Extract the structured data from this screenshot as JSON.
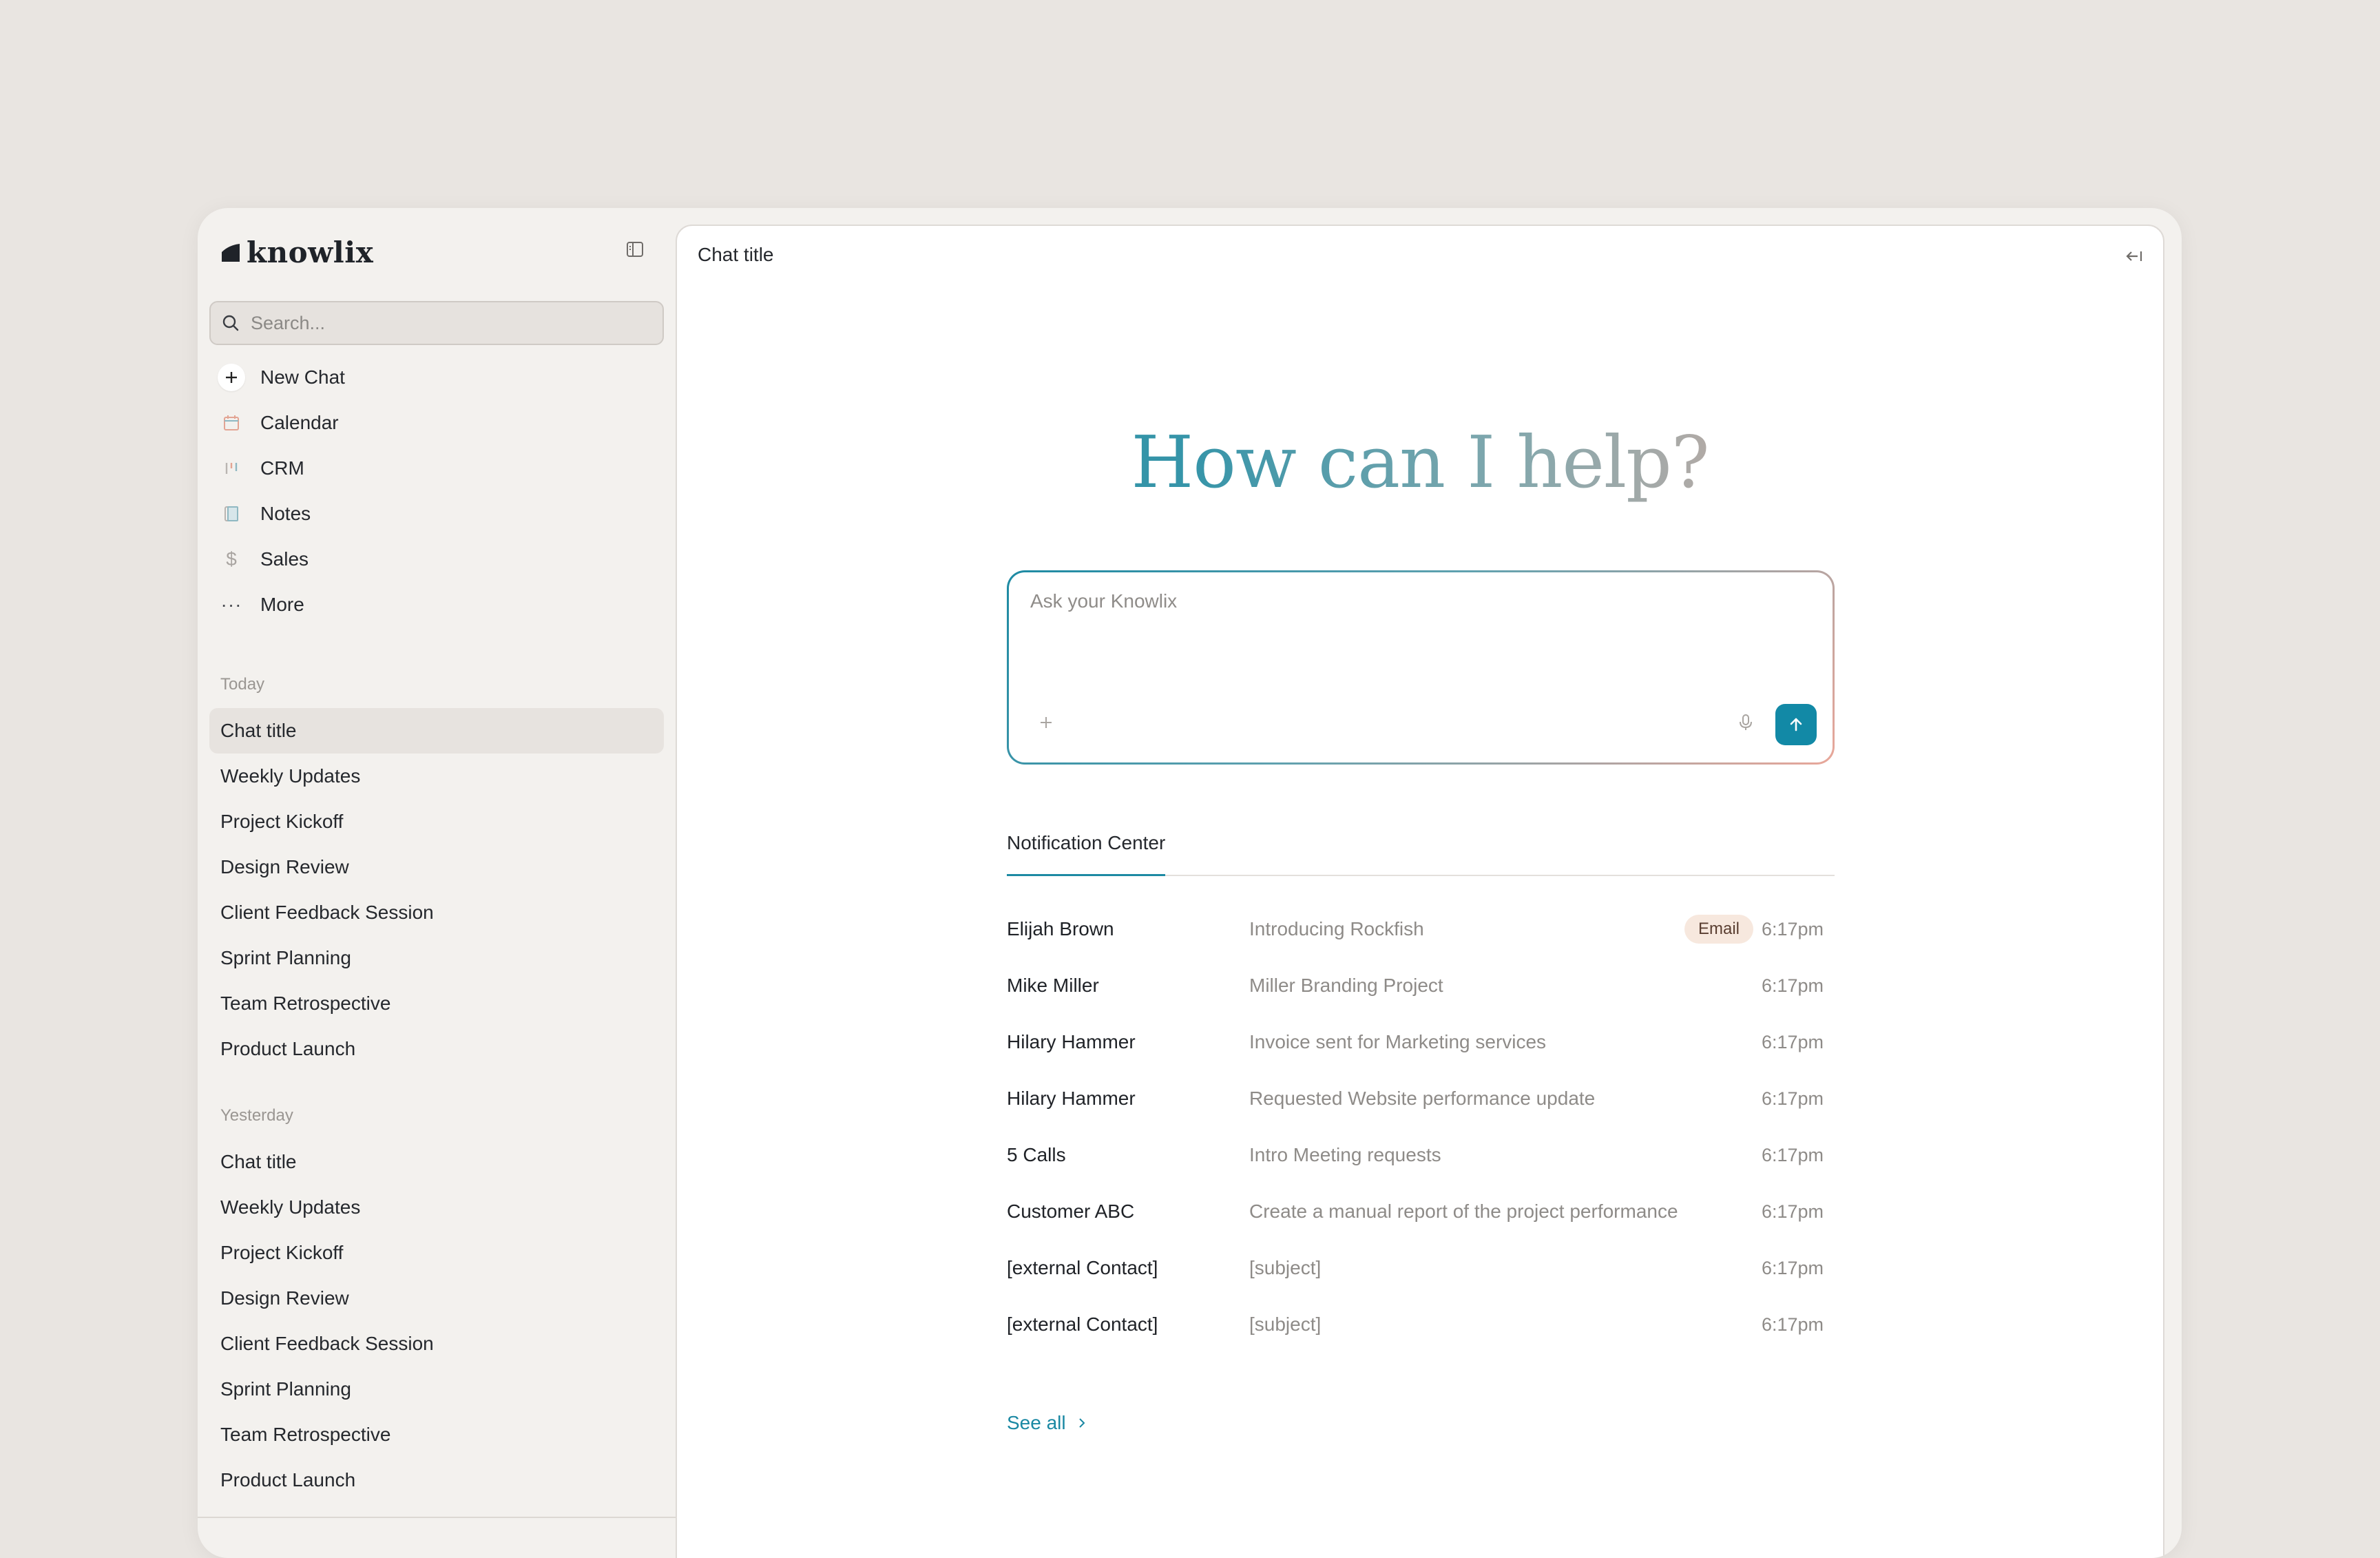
{
  "brand": {
    "name": "knowlix"
  },
  "search": {
    "placeholder": "Search..."
  },
  "nav": [
    {
      "label": "New Chat",
      "icon": "plus-icon"
    },
    {
      "label": "Calendar",
      "icon": "calendar-icon"
    },
    {
      "label": "CRM",
      "icon": "crm-icon"
    },
    {
      "label": "Notes",
      "icon": "notes-icon"
    },
    {
      "label": "Sales",
      "icon": "dollar-icon"
    },
    {
      "label": "More",
      "icon": "ellipsis-icon"
    }
  ],
  "history": {
    "today_label": "Today",
    "today": [
      "Chat title",
      "Weekly Updates",
      "Project Kickoff",
      "Design Review",
      "Client Feedback Session",
      "Sprint Planning",
      "Team Retrospective",
      "Product Launch"
    ],
    "yesterday_label": "Yesterday",
    "yesterday": [
      "Chat title",
      "Weekly Updates",
      "Project Kickoff",
      "Design Review",
      "Client Feedback Session",
      "Sprint Planning",
      "Team Retrospective",
      "Product Launch"
    ]
  },
  "header": {
    "title": "Chat title"
  },
  "hero": {
    "title": "How can I help?"
  },
  "prompt": {
    "placeholder": "Ask your Knowlix"
  },
  "notifications": {
    "tab": "Notification Center",
    "rows": [
      {
        "sender": "Elijah Brown",
        "subject": "Introducing Rockfish",
        "badge": "Email",
        "time": "6:17pm"
      },
      {
        "sender": "Mike Miller",
        "subject": "Miller Branding Project",
        "badge": "",
        "time": "6:17pm"
      },
      {
        "sender": "Hilary Hammer",
        "subject": "Invoice sent for Marketing services",
        "badge": "",
        "time": "6:17pm"
      },
      {
        "sender": "Hilary Hammer",
        "subject": "Requested Website performance update",
        "badge": "",
        "time": "6:17pm"
      },
      {
        "sender": "5 Calls",
        "subject": "Intro Meeting requests",
        "badge": "",
        "time": "6:17pm"
      },
      {
        "sender": "Customer ABC",
        "subject": "Create a manual report of the project performance",
        "badge": "",
        "time": "6:17pm"
      },
      {
        "sender": "[external Contact]",
        "subject": "[subject]",
        "badge": "",
        "time": "6:17pm"
      },
      {
        "sender": "[external Contact]",
        "subject": "[subject]",
        "badge": "",
        "time": "6:17pm"
      }
    ],
    "see_all": "See all"
  },
  "colors": {
    "accent": "#1289a6",
    "background": "#e9e5e1",
    "sidebar": "#f3f1ee",
    "badge_bg": "#f7e8de"
  }
}
